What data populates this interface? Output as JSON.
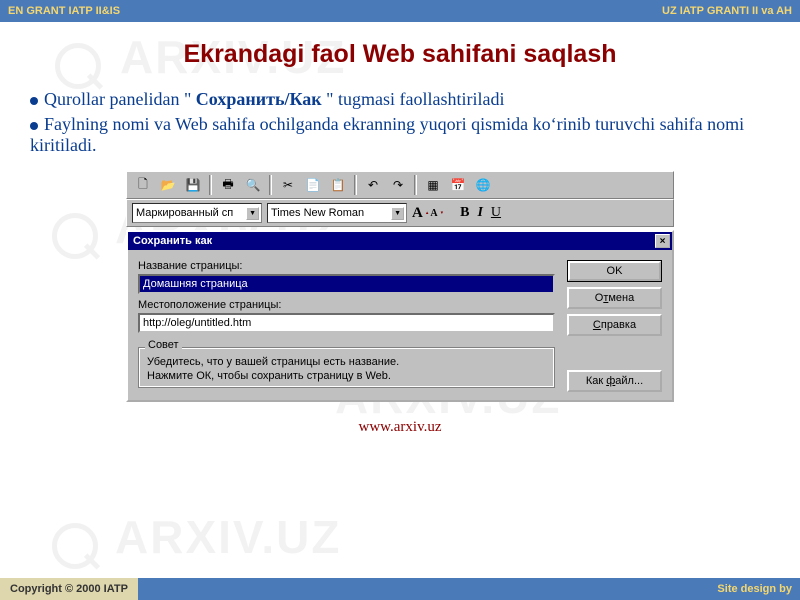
{
  "header": {
    "left": "EN GRANT IATP II&IS",
    "right": "UZ  IATP GRANTI II va AH"
  },
  "title": "Ekrandagi faol  Web sahifani saqlash",
  "bullets": {
    "line1a": "Qurollar panelidan \" ",
    "line1bold": "Сохранить/Как",
    "line1b": " \" tugmasi faollashtiriladi",
    "line2": "Faylning nomi va Web sahifa ochilganda ekranning yuqori qismida koʻrinib turuvchi sahifa nomi kiritiladi."
  },
  "toolbar": {
    "icons": {
      "new": "🗋",
      "open": "📂",
      "save": "💾",
      "print": "🖶",
      "preview": "🔍",
      "cut": "✂",
      "copy": "📄",
      "paste": "📋",
      "undo": "↶",
      "redo": "↷",
      "table": "▦",
      "calendar": "📅",
      "web": "🌐"
    }
  },
  "formatbar": {
    "style": "Маркированный сп",
    "font": "Times New Roman",
    "bold": "B",
    "italic": "I",
    "underline": "U"
  },
  "dialog": {
    "title": "Сохранить как",
    "close": "×",
    "label_name": "Название страницы:",
    "value_name": "Домашняя страница",
    "label_loc": "Местоположение страницы:",
    "value_loc": "http://oleg/untitled.htm",
    "tip_label": "Совет",
    "tip1": "Убедитесь, что у вашей страницы есть название.",
    "tip2": "Нажмите ОК, чтобы сохранить страницу в Web.",
    "ok": "OK",
    "cancel_pre": "О",
    "cancel_u": "т",
    "cancel_post": "мена",
    "help_u": "С",
    "help_post": "правка",
    "asfile_pre": "Как ",
    "asfile_u": "ф",
    "asfile_post": "айл..."
  },
  "url": "www.arxiv.uz",
  "watermark": "ARXIV.UZ",
  "footer": {
    "left": "Copyright © 2000 IATP",
    "right": "Site design by"
  }
}
